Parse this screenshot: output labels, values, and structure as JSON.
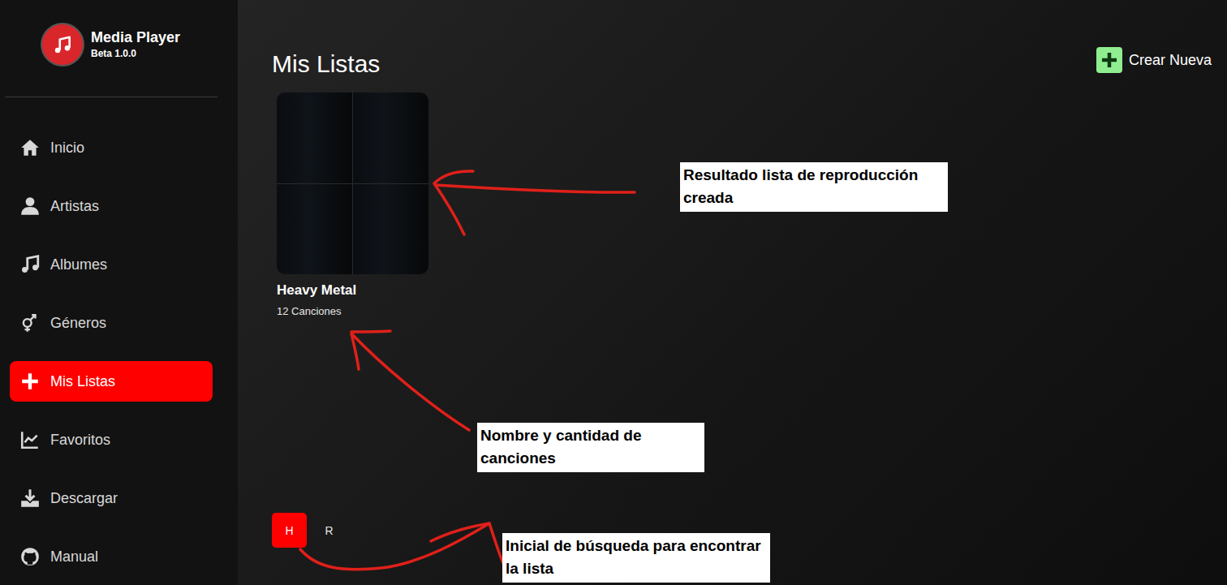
{
  "app": {
    "name": "Media Player",
    "version": "Beta 1.0.0"
  },
  "sidebar": {
    "items": [
      {
        "label": "Inicio",
        "selected": false
      },
      {
        "label": "Artistas",
        "selected": false
      },
      {
        "label": "Albumes",
        "selected": false
      },
      {
        "label": "Géneros",
        "selected": false
      },
      {
        "label": "Mis Listas",
        "selected": true
      },
      {
        "label": "Favoritos",
        "selected": false
      },
      {
        "label": "Descargar",
        "selected": false
      },
      {
        "label": "Manual",
        "selected": false
      }
    ]
  },
  "page": {
    "title": "Mis Listas",
    "create_button": "Crear Nueva"
  },
  "playlists": [
    {
      "name": "Heavy Metal",
      "count": "12 Canciones",
      "covers": 4
    }
  ],
  "letters": [
    {
      "label": "H",
      "selected": true
    },
    {
      "label": "R",
      "selected": false
    }
  ],
  "annotations": [
    {
      "text": "Resultado lista de reproducción creada"
    },
    {
      "text": "Nombre y cantidad de canciones"
    },
    {
      "text": "Inicial de búsqueda para encontrar la lista"
    }
  ]
}
